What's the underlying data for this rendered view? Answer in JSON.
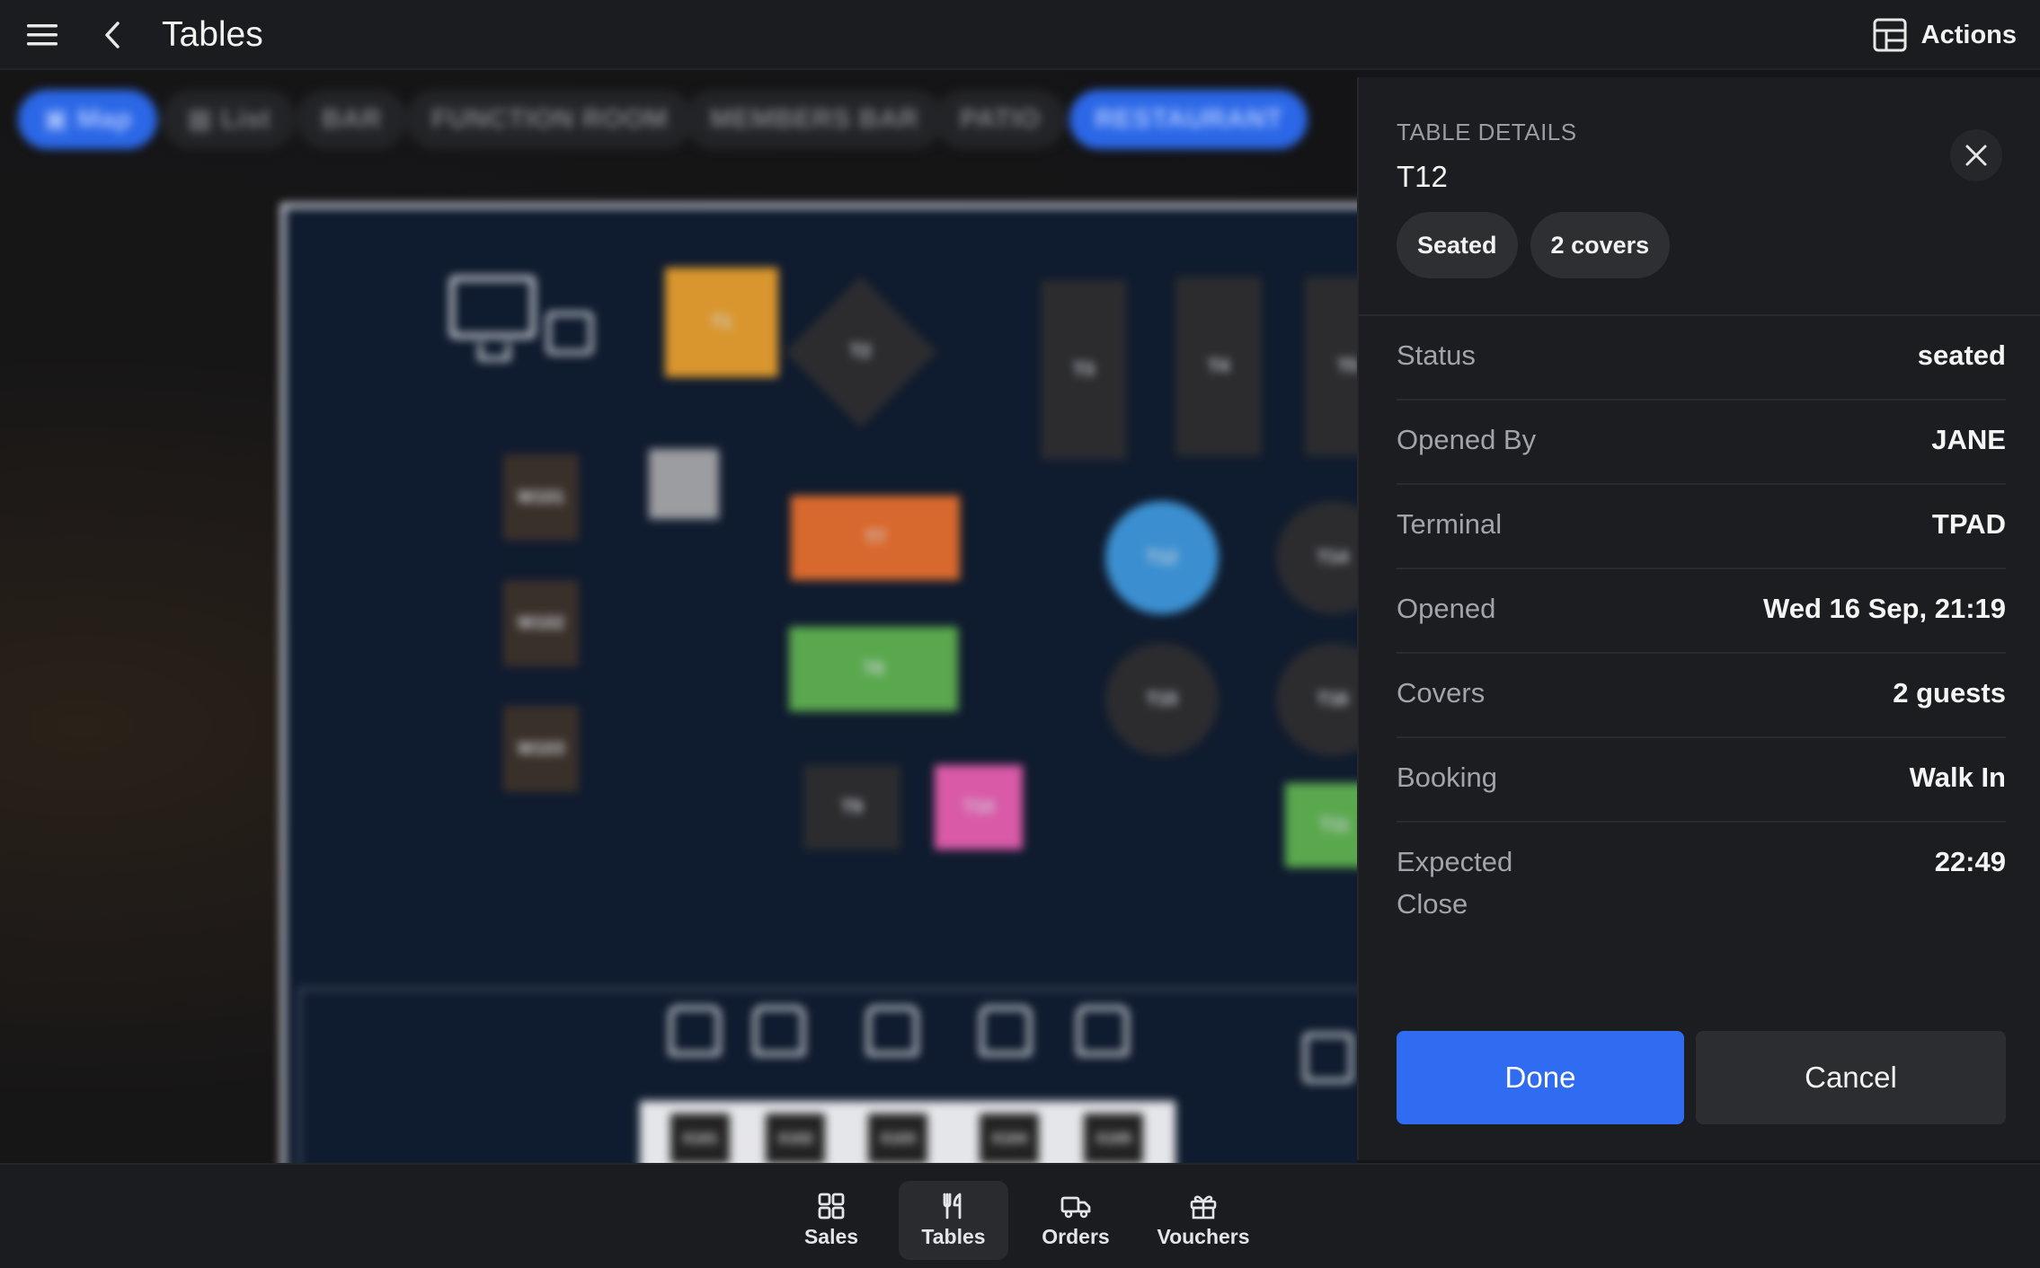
{
  "header": {
    "title": "Tables",
    "actions_label": "Actions"
  },
  "view_chips": [
    {
      "label": "Map",
      "active": true
    },
    {
      "label": "List",
      "active": false
    },
    {
      "label": "BAR",
      "active": false
    },
    {
      "label": "FUNCTION ROOM",
      "active": false
    },
    {
      "label": "MEMBERS BAR",
      "active": false
    },
    {
      "label": "PATIO",
      "active": false
    },
    {
      "label": "RESTAURANT",
      "active": true
    }
  ],
  "floor_tables": {
    "t1": "T1",
    "t2": "T2",
    "t3": "T3",
    "t4": "T4",
    "t5": "T5",
    "t7": "T7",
    "t8": "T8",
    "t9": "T9",
    "t10": "T10",
    "t11": "T11",
    "t12": "T12",
    "t14": "T14",
    "t15": "T15",
    "t16": "T16",
    "w101": "W101",
    "w102": "W102",
    "w103": "W103",
    "x101": "X101",
    "x102": "X102",
    "x103": "X103",
    "x104": "X104",
    "x105": "X105"
  },
  "details": {
    "eyebrow": "TABLE DETAILS",
    "table_name": "T12",
    "badges": [
      "Seated",
      "2 covers"
    ],
    "rows": [
      {
        "label": "Status",
        "value": "seated"
      },
      {
        "label": "Opened By",
        "value": "JANE"
      },
      {
        "label": "Terminal",
        "value": "TPAD"
      },
      {
        "label": "Opened",
        "value": "Wed 16 Sep, 21:19"
      },
      {
        "label": "Covers",
        "value": "2 guests"
      },
      {
        "label": "Booking",
        "value": "Walk In"
      },
      {
        "label": "Expected Close",
        "value": "22:49"
      }
    ],
    "done_label": "Done",
    "cancel_label": "Cancel"
  },
  "bottom_nav": [
    {
      "label": "Sales",
      "icon": "grid-icon",
      "active": false
    },
    {
      "label": "Tables",
      "icon": "fork-knife-icon",
      "active": true
    },
    {
      "label": "Orders",
      "icon": "delivery-truck-icon",
      "active": false
    },
    {
      "label": "Vouchers",
      "icon": "gift-icon",
      "active": false
    }
  ],
  "colors": {
    "accent": "#2f6cf2",
    "panel_bg": "#1c1d21",
    "t1": "#d9962e",
    "t7": "#d8692e",
    "t8": "#5aa84e",
    "t10": "#d95aa7",
    "t12": "#3b8fd0"
  }
}
